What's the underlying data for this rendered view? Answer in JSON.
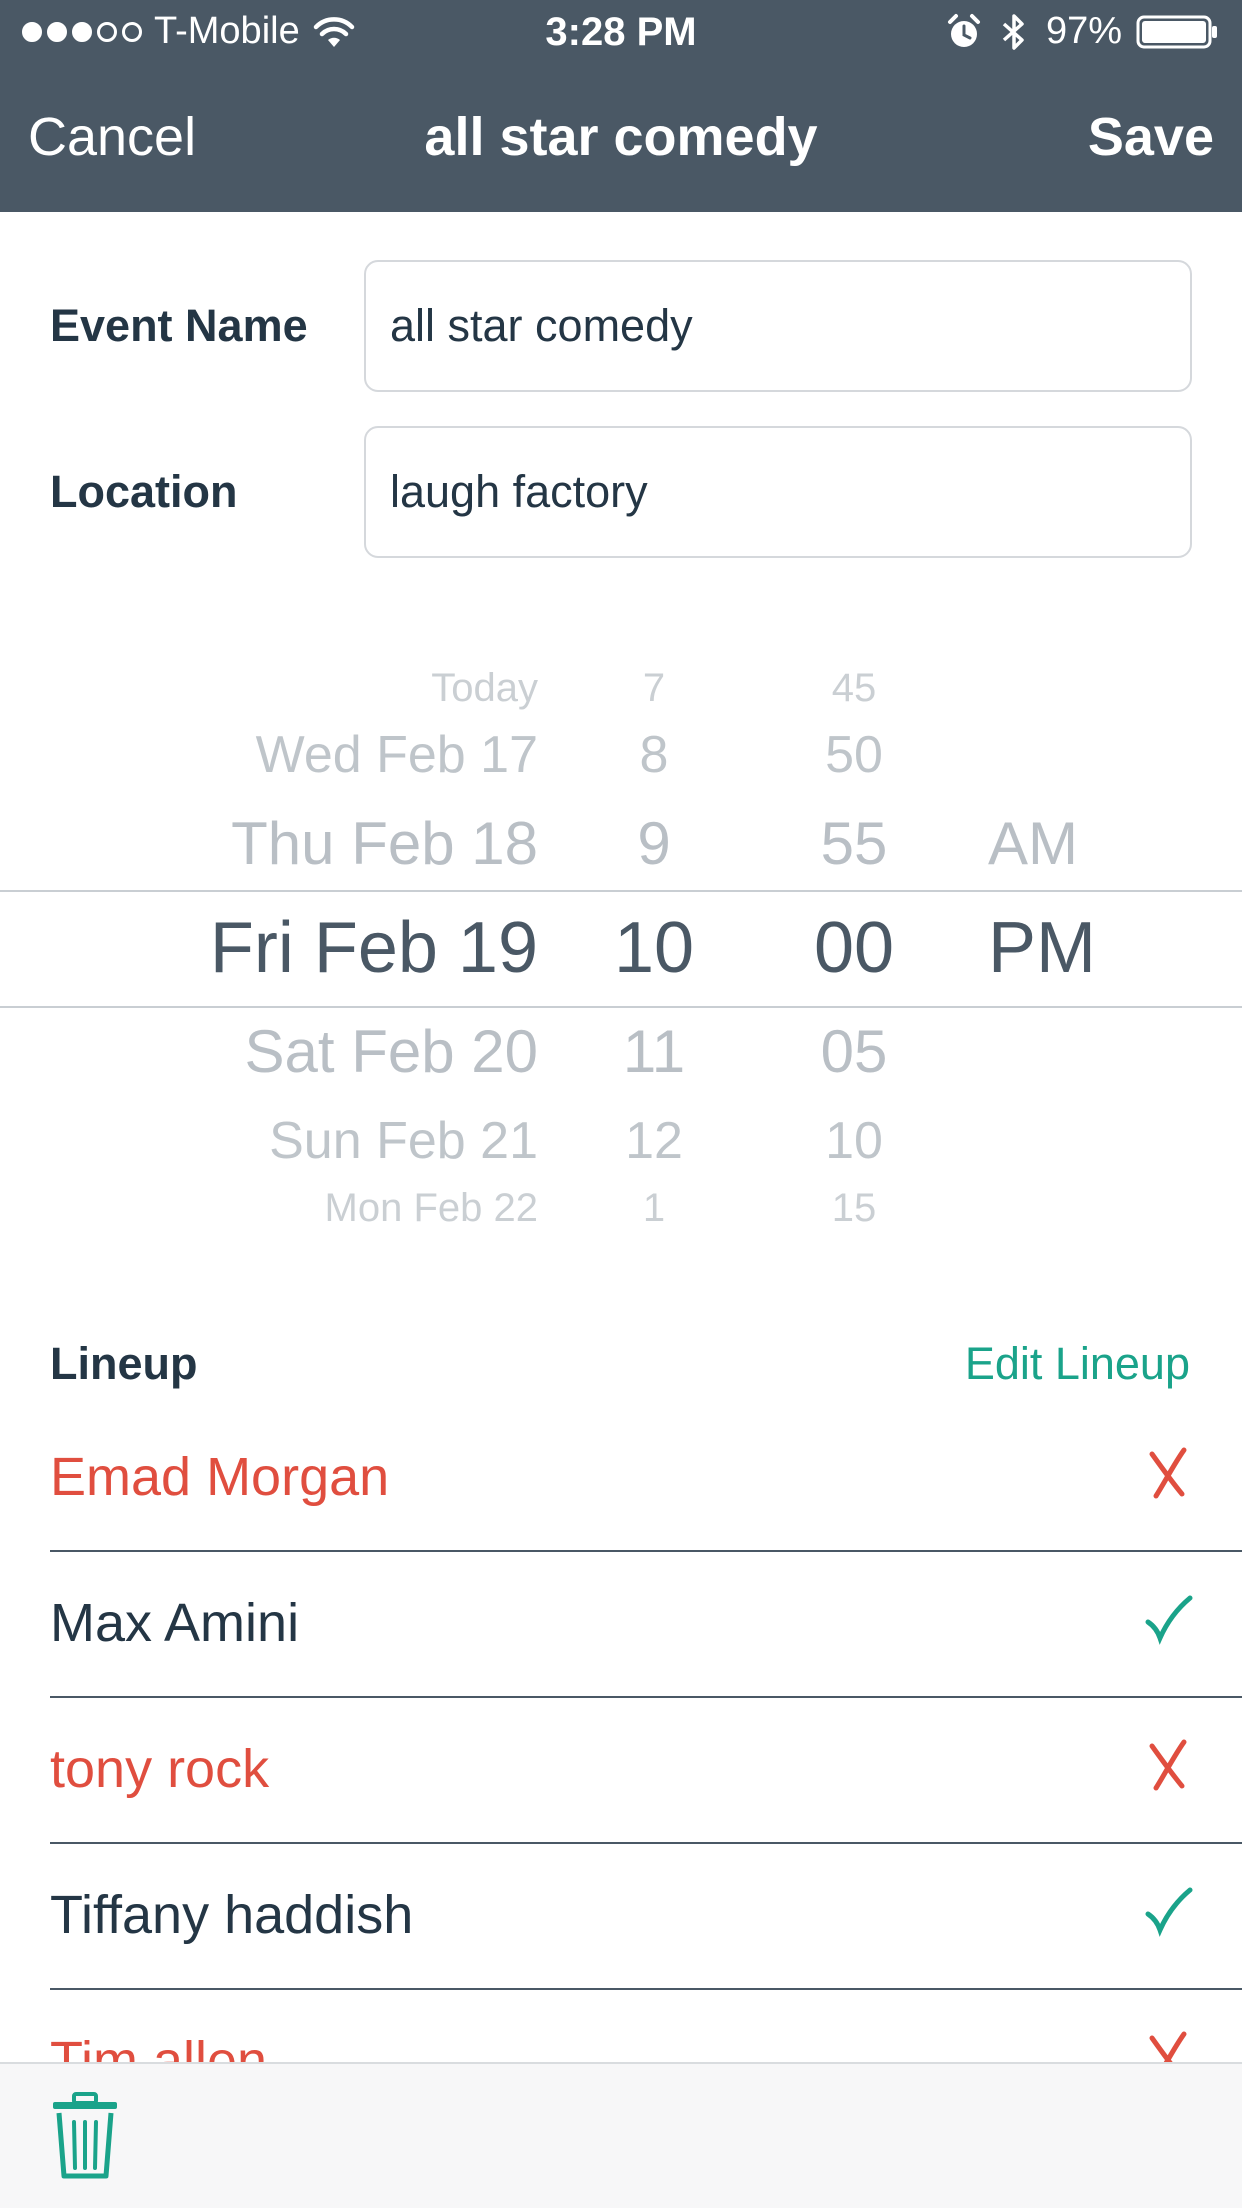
{
  "status_bar": {
    "signal_bars_filled": 3,
    "signal_bars_total": 5,
    "carrier": "T-Mobile",
    "time": "3:28 PM",
    "battery": "97%",
    "icons": [
      "wifi-icon",
      "alarm-icon",
      "bluetooth-icon",
      "battery-icon"
    ]
  },
  "navbar": {
    "cancel_label": "Cancel",
    "title": "all star comedy",
    "save_label": "Save"
  },
  "form": {
    "event_name_label": "Event Name",
    "event_name_value": "all star comedy",
    "location_label": "Location",
    "location_value": "laugh factory"
  },
  "date_picker": {
    "selected": {
      "date": "Fri Feb 19",
      "hour": "10",
      "minute": "00",
      "ampm": "PM"
    },
    "rows": [
      {
        "date": "Today",
        "hour": "7",
        "minute": "45",
        "ampm": "",
        "offset": -4
      },
      {
        "date": "Wed Feb 17",
        "hour": "8",
        "minute": "50",
        "ampm": "",
        "offset": -3
      },
      {
        "date": "Thu Feb 18",
        "hour": "9",
        "minute": "55",
        "ampm": "AM",
        "offset": -2
      },
      {
        "date": "Fri Feb 19",
        "hour": "10",
        "minute": "00",
        "ampm": "PM",
        "offset": 0
      },
      {
        "date": "Sat Feb 20",
        "hour": "11",
        "minute": "05",
        "ampm": "",
        "offset": 2
      },
      {
        "date": "Sun Feb 21",
        "hour": "12",
        "minute": "10",
        "ampm": "",
        "offset": 3
      },
      {
        "date": "Mon Feb 22",
        "hour": "1",
        "minute": "15",
        "ampm": "",
        "offset": 4
      }
    ]
  },
  "lineup": {
    "title": "Lineup",
    "edit_label": "Edit Lineup",
    "items": [
      {
        "name": "Emad Morgan",
        "status": "declined"
      },
      {
        "name": "Max Amini",
        "status": "confirmed"
      },
      {
        "name": "tony rock",
        "status": "declined"
      },
      {
        "name": "Tiffany haddish",
        "status": "confirmed"
      },
      {
        "name": "Tim allen",
        "status": "declined"
      }
    ]
  },
  "colors": {
    "header_bg": "#4a5865",
    "text_dark": "#243645",
    "accent_green": "#1aa38a",
    "declined_red": "#e04e3f",
    "picker_selected": "#4a5865",
    "picker_faded": "#b9bfc5"
  },
  "toolbar": {
    "icon": "trash-icon"
  }
}
